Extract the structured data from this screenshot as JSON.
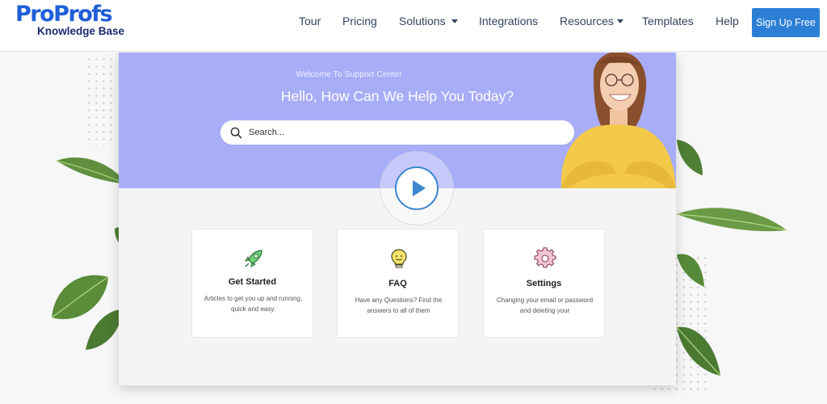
{
  "header": {
    "logo": {
      "main": "ProProfs",
      "sub": "Knowledge Base"
    },
    "nav": [
      {
        "label": "Tour",
        "dropdown": false
      },
      {
        "label": "Pricing",
        "dropdown": false
      },
      {
        "label": "Solutions",
        "dropdown": true
      },
      {
        "label": "Integrations",
        "dropdown": false
      },
      {
        "label": "Resources",
        "dropdown": true
      },
      {
        "label": "Templates",
        "dropdown": false
      },
      {
        "label": "Help",
        "dropdown": false
      }
    ],
    "cta_label": "Sign Up Free"
  },
  "hero": {
    "welcome": "Welcome To Support Center",
    "headline": "Hello, How Can We Help You Today?",
    "search_placeholder": "Search..."
  },
  "tiles": [
    {
      "title": "Get Started",
      "description": "Articles to get you up and running, quick and easy.",
      "icon": "rocket-icon"
    },
    {
      "title": "FAQ",
      "description": "Have any Questions? Find the answers to all of them",
      "icon": "lightbulb-icon"
    },
    {
      "title": "Settings",
      "description": "Changing your email or password and deleting your",
      "icon": "gear-icon"
    }
  ],
  "colors": {
    "brand_blue": "#1f5fd8",
    "cta_blue": "#2d7fd6",
    "hero_lavender": "#a8adf8",
    "play_accent": "#3d86cf"
  }
}
